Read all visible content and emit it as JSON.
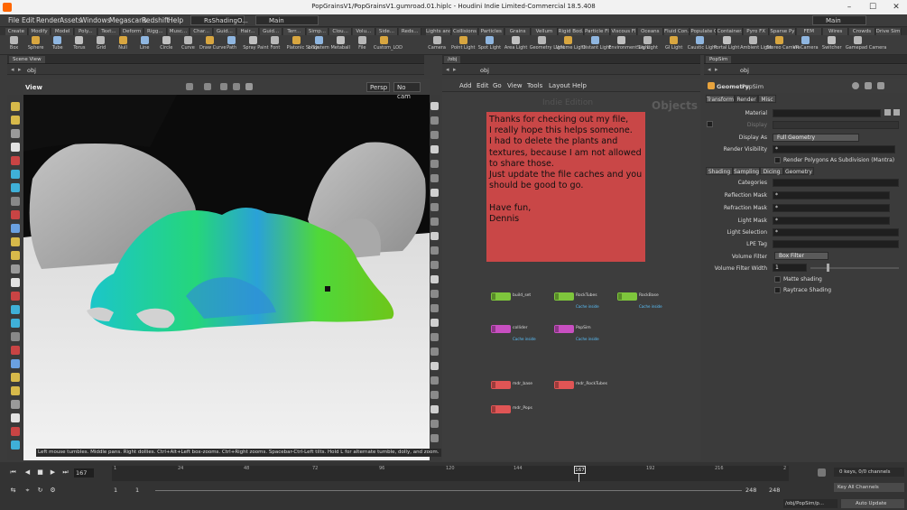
{
  "window": {
    "title": "PopGrainsV1/PopGrainsV1.gumroad.01.hiplc - Houdini Indie Limited-Commercial 18.5.408"
  },
  "menubar": {
    "items": [
      "File",
      "Edit",
      "Render",
      "Assets",
      "Windows",
      "Megascans",
      "Redshift",
      "Help"
    ],
    "desktop": "RsShadingO...",
    "layout": "Main",
    "right_layout": "Main"
  },
  "shelf_left": {
    "tabs": [
      "Create",
      "Modify",
      "Model",
      "Poly...",
      "Text...",
      "Deform",
      "Rigg...",
      "Musc...",
      "Char...",
      "Guid...",
      "Hair...",
      "Guid...",
      "Terr...",
      "Simp...",
      "Clou...",
      "Volu...",
      "Side...",
      "Reds..."
    ],
    "tools": [
      "Box",
      "Sphere",
      "Tube",
      "Torus",
      "Grid",
      "Null",
      "Line",
      "Circle",
      "Curve",
      "Draw Curve",
      "Path",
      "Spray Paint",
      "Font",
      "Platonic Solids",
      "L-System",
      "Metaball",
      "File",
      "Custom_LOD"
    ]
  },
  "shelf_right": {
    "tabs": [
      "Lights and...",
      "Collisions",
      "Particles",
      "Grains",
      "Vellum",
      "Rigid Bod...",
      "Particle Fl...",
      "Viscous Fl...",
      "Oceans",
      "Fluid Con...",
      "Populate C...",
      "Container...",
      "Pyro FX",
      "Sparse Pyr...",
      "FEM",
      "Wires",
      "Crowds",
      "Drive Sim..."
    ],
    "tools": [
      "Camera",
      "Point Light",
      "Spot Light",
      "Area Light",
      "Geometry Light",
      "Volume Light",
      "Distant Light",
      "Environment Light",
      "Sky Light",
      "GI Light",
      "Caustic Light",
      "Portal Light",
      "Ambient Light",
      "Stereo Camera",
      "VR Camera",
      "Switcher",
      "Gamepad Camera"
    ]
  },
  "scene_view": {
    "tab": "Scene View",
    "path": "obj",
    "label": "View",
    "camera_persp": "Persp",
    "camera_cam": "No cam",
    "status": "Left mouse tumbles. Middle pans. Right dollies. Ctrl+Alt+Left box-zooms. Ctrl+Right zooms. Spacebar-Ctrl-Left tilts. Hold L for alternate tumble, dolly, and zoom."
  },
  "network": {
    "tab": "/obj",
    "path": "obj",
    "menu": [
      "Add",
      "Edit",
      "Go",
      "View",
      "Tools",
      "Layout",
      "Help"
    ],
    "watermark": "Indie Edition",
    "context_label": "Objects",
    "sticky_note": "Thanks for checking out my file,\nI really hope this helps someone.\nI had to delete the plants and textures, because I am not allowed to share those.\nJust update the file caches and you should be good to go.\n\nHave fun,\nDennis",
    "nodes": [
      {
        "label": "build_set",
        "sub": "",
        "color": "#7ec63c"
      },
      {
        "label": "RockTubes",
        "sub": "Cache inside",
        "color": "#7ec63c"
      },
      {
        "label": "RockBase",
        "sub": "Cache inside",
        "color": "#7ec63c"
      },
      {
        "label": "collider",
        "sub": "Cache inside",
        "color": "#c84fc1"
      },
      {
        "label": "PopSim",
        "sub": "Cache inside",
        "color": "#c84fc1"
      },
      {
        "label": "mdr_base",
        "sub": "",
        "color": "#e05555"
      },
      {
        "label": "mdr_RockTubes",
        "sub": "",
        "color": "#e05555"
      },
      {
        "label": "mdr_Pops",
        "sub": "",
        "color": "#e05555"
      }
    ]
  },
  "params": {
    "tab": "PopSim",
    "path": "obj",
    "node_type": "Geometry",
    "node_name": "PopSim",
    "tabs": [
      "Transform",
      "Render",
      "Misc"
    ],
    "material_label": "Material",
    "display_label": "Display",
    "display_as_label": "Display As",
    "display_as_value": "Full Geometry",
    "render_visibility_label": "Render Visibility",
    "render_visibility_value": "*",
    "render_polygons_label": "Render Polygons As Subdivision (Mantra)",
    "subtabs": [
      "Shading",
      "Sampling",
      "Dicing",
      "Geometry"
    ],
    "categories_label": "Categories",
    "reflection_mask_label": "Reflection Mask",
    "reflection_mask_value": "*",
    "refraction_mask_label": "Refraction Mask",
    "refraction_mask_value": "*",
    "light_mask_label": "Light Mask",
    "light_mask_value": "*",
    "light_selection_label": "Light Selection",
    "light_selection_value": "*",
    "lpe_tag_label": "LPE Tag",
    "volume_filter_label": "Volume Filter",
    "volume_filter_value": "Box Filter",
    "volume_filter_width_label": "Volume Filter Width",
    "volume_filter_width_value": "1",
    "matte_label": "Matte shading",
    "raytrace_label": "Raytrace Shading"
  },
  "timeline": {
    "current_frame": "167",
    "ticks": [
      "1",
      "24",
      "48",
      "72",
      "96",
      "120",
      "144",
      "192",
      "216",
      "2"
    ],
    "start": "1",
    "start2": "1",
    "end": "248",
    "end2": "248",
    "keys_info": "0 keys, 0/0 channels",
    "key_all": "Key All Channels",
    "path": "/obj/PopSim/p...",
    "auto_update": "Auto Update"
  }
}
